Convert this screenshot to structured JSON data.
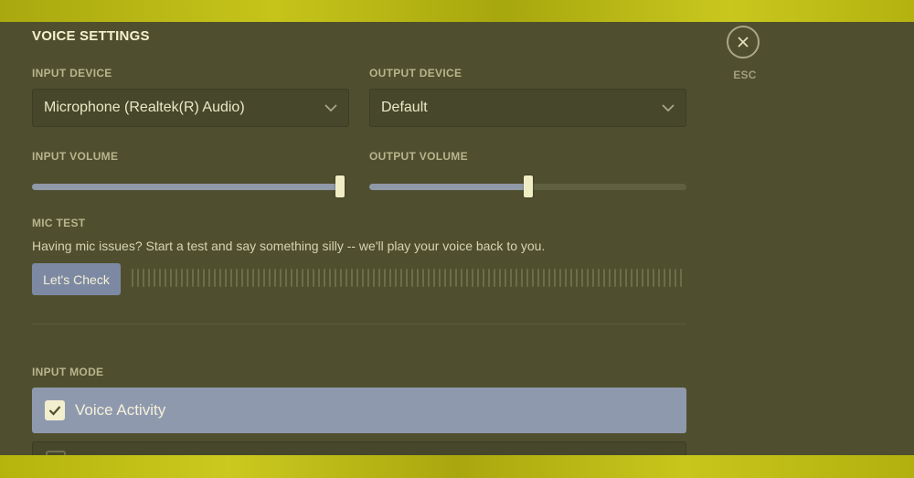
{
  "heading": "VOICE SETTINGS",
  "input_device": {
    "label": "INPUT DEVICE",
    "value": "Microphone (Realtek(R) Audio)",
    "icon": "chevron-down-icon"
  },
  "output_device": {
    "label": "OUTPUT DEVICE",
    "value": "Default",
    "icon": "chevron-down-icon"
  },
  "input_volume": {
    "label": "INPUT VOLUME",
    "level": 1.0
  },
  "output_volume": {
    "label": "OUTPUT VOLUME",
    "level": 0.5
  },
  "mic_test": {
    "label": "MIC TEST",
    "description": "Having mic issues? Start a test and say something silly -- we'll play your voice back to you.",
    "button": "Let's Check"
  },
  "input_mode": {
    "label": "INPUT MODE",
    "options": [
      {
        "label": "Voice Activity",
        "selected": true
      },
      {
        "label": "",
        "selected": false
      }
    ]
  },
  "esc": {
    "label": "ESC",
    "icon": "close-icon"
  },
  "colors": {
    "accent": "#8f99ae",
    "panel": "#4f4f2f",
    "background_band": "#b8b60d",
    "text": "#f4f1ce"
  }
}
